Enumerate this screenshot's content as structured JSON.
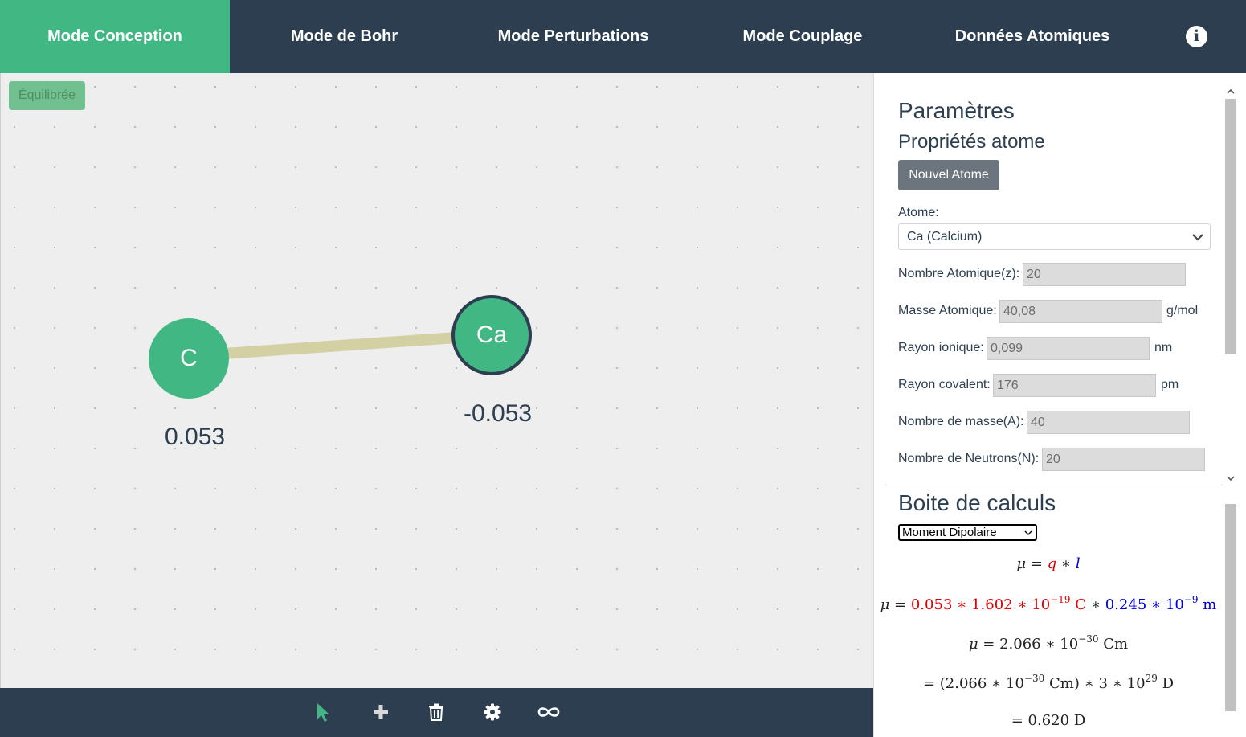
{
  "nav": {
    "tabs": [
      {
        "label": "Mode Conception",
        "active": true
      },
      {
        "label": "Mode de Bohr",
        "active": false
      },
      {
        "label": "Mode Perturbations",
        "active": false
      },
      {
        "label": "Mode Couplage",
        "active": false
      },
      {
        "label": "Données Atomiques",
        "active": false
      }
    ],
    "info_icon": "info-icon"
  },
  "canvas": {
    "equilibrium_button": "Équilibrée",
    "atoms": [
      {
        "symbol": "C",
        "charge": "0.053"
      },
      {
        "symbol": "Ca",
        "charge": "-0.053",
        "selected": true
      }
    ],
    "bond_color": "#d3d1a4",
    "atom_color": "#41b883"
  },
  "toolbar": {
    "tools": [
      "select-cursor-icon",
      "add-plus-icon",
      "trash-icon",
      "gear-icon",
      "infinity-icon"
    ],
    "active_tool": "select-cursor-icon"
  },
  "panel": {
    "title": "Paramètres",
    "subtitle": "Propriétés atome",
    "new_atom_button": "Nouvel Atome",
    "atom_label": "Atome:",
    "atom_selected": "Ca (Calcium)",
    "fields": [
      {
        "label": "Nombre Atomique(z):",
        "value": "20",
        "unit": ""
      },
      {
        "label": "Masse Atomique:",
        "value": "40,08",
        "unit": "g/mol"
      },
      {
        "label": "Rayon ionique:",
        "value": "0,099",
        "unit": "nm"
      },
      {
        "label": "Rayon covalent:",
        "value": "176",
        "unit": "pm"
      },
      {
        "label": "Nombre de masse(A):",
        "value": "40",
        "unit": ""
      },
      {
        "label": "Nombre de Neutrons(N):",
        "value": "20",
        "unit": ""
      }
    ]
  },
  "calc": {
    "title": "Boite de calculs",
    "selected": "Moment Dipolaire",
    "eq2": {
      "q": "0.053",
      "e": "1.602",
      "e_exp": "−19",
      "q_unit": "C",
      "l": "0.245",
      "l_exp": "−9",
      "l_unit": "m"
    },
    "eq3": {
      "value": "2.066",
      "exp": "−30",
      "unit": "Cm"
    },
    "eq4": {
      "value": "2.066",
      "exp": "−30",
      "unit": "Cm",
      "factor": "3",
      "factor_exp": "29",
      "result_unit": "D"
    },
    "eq5": {
      "value": "0.620",
      "unit": "D"
    }
  },
  "colors": {
    "nav": "#2c3e50",
    "accent": "#41b883",
    "q_color": "#e00000",
    "l_color": "#0000dd"
  }
}
